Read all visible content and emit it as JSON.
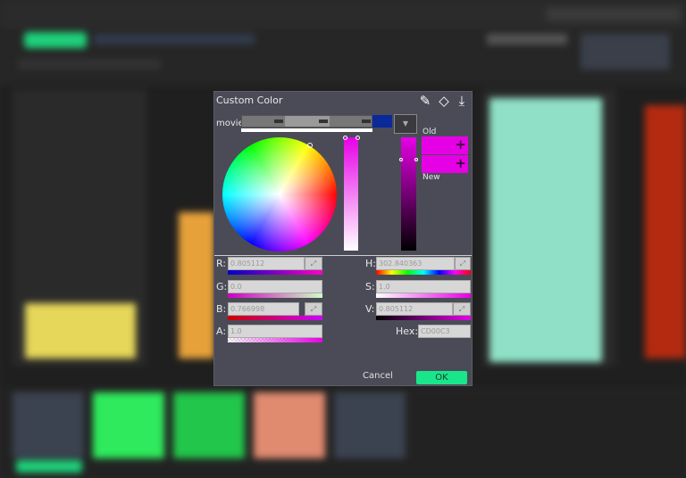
{
  "dialog": {
    "title": "Custom Color",
    "toolbar": {
      "pick_icon": "✎",
      "shape_icon": "◇",
      "save_icon": "⤓"
    },
    "preset_label": "movie",
    "old_label": "Old",
    "new_label": "New",
    "swatch_plus": "+",
    "fields": {
      "r": {
        "label": "R:",
        "value": "0.805112"
      },
      "g": {
        "label": "G:",
        "value": "0.0"
      },
      "b": {
        "label": "B:",
        "value": "0.766998"
      },
      "a": {
        "label": "A:",
        "value": "1.0"
      },
      "h": {
        "label": "H:",
        "value": "302.840363"
      },
      "s": {
        "label": "S:",
        "value": "1.0"
      },
      "v": {
        "label": "V:",
        "value": "0.805112"
      },
      "hex": {
        "label": "Hex:",
        "value": "CD00C3"
      }
    },
    "spin_glyph": "⤢",
    "dropdown_glyph": "▼",
    "cancel_label": "Cancel",
    "ok_label": "OK"
  },
  "colors": {
    "accent": "#19e68a",
    "current": "#e600e6",
    "dialog_bg": "#4b4b57"
  }
}
